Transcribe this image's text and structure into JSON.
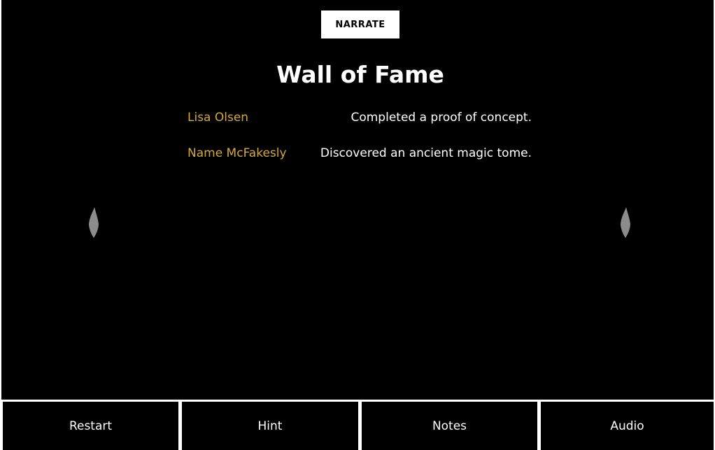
{
  "header": {
    "narrate_label": "NARRATE",
    "title": "Wall of Fame"
  },
  "wall_of_fame": {
    "entries": [
      {
        "name": "Lisa Olsen",
        "achievement": "Completed a proof of concept."
      },
      {
        "name": "Name McFakesly",
        "achievement": "Discovered an ancient magic tome."
      }
    ]
  },
  "decorations": {
    "left_icon": "torch-flame-icon",
    "right_icon": "torch-flame-icon"
  },
  "toolbar": {
    "restart_label": "Restart",
    "hint_label": "Hint",
    "notes_label": "Notes",
    "audio_label": "Audio"
  },
  "colors": {
    "background": "#000000",
    "name_accent": "#d4a93b",
    "text": "#ffffff",
    "flame": "#8c8c8c"
  }
}
